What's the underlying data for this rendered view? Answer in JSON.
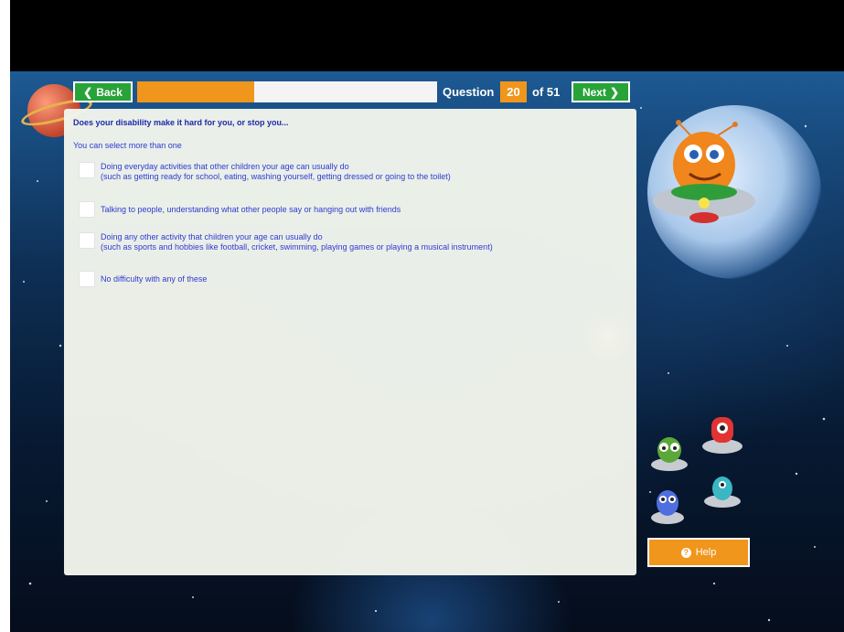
{
  "nav": {
    "back_label": "Back",
    "back_icon": "chevron-left-icon",
    "next_label": "Next",
    "next_icon": "chevron-right-icon"
  },
  "progress": {
    "value": 0.39
  },
  "question": {
    "label": "Question",
    "number": "20",
    "of_label": "of 51",
    "title": "Does your disability make it hard for you, or stop you...",
    "hint": "You can select more than one"
  },
  "options": [
    {
      "line1": "Doing everyday activities that other children your age can usually do",
      "line2": "(such as getting ready for school, eating, washing yourself, getting dressed or going to the toilet)"
    },
    {
      "line1": "Talking to people, understanding what other people say or hanging out with friends",
      "line2": ""
    },
    {
      "line1": "Doing any other activity that children your age can usually do",
      "line2": "(such as sports and hobbies like football, cricket, swimming, playing games or playing a musical instrument)"
    },
    {
      "line1": "No difficulty with any of these",
      "line2": ""
    }
  ],
  "help": {
    "label": "Help",
    "icon": "question-circle-icon"
  },
  "colors": {
    "green": "#27a338",
    "orange": "#f0961c",
    "text_blue": "#2f3bd0",
    "title_blue": "#1f2aa8"
  }
}
